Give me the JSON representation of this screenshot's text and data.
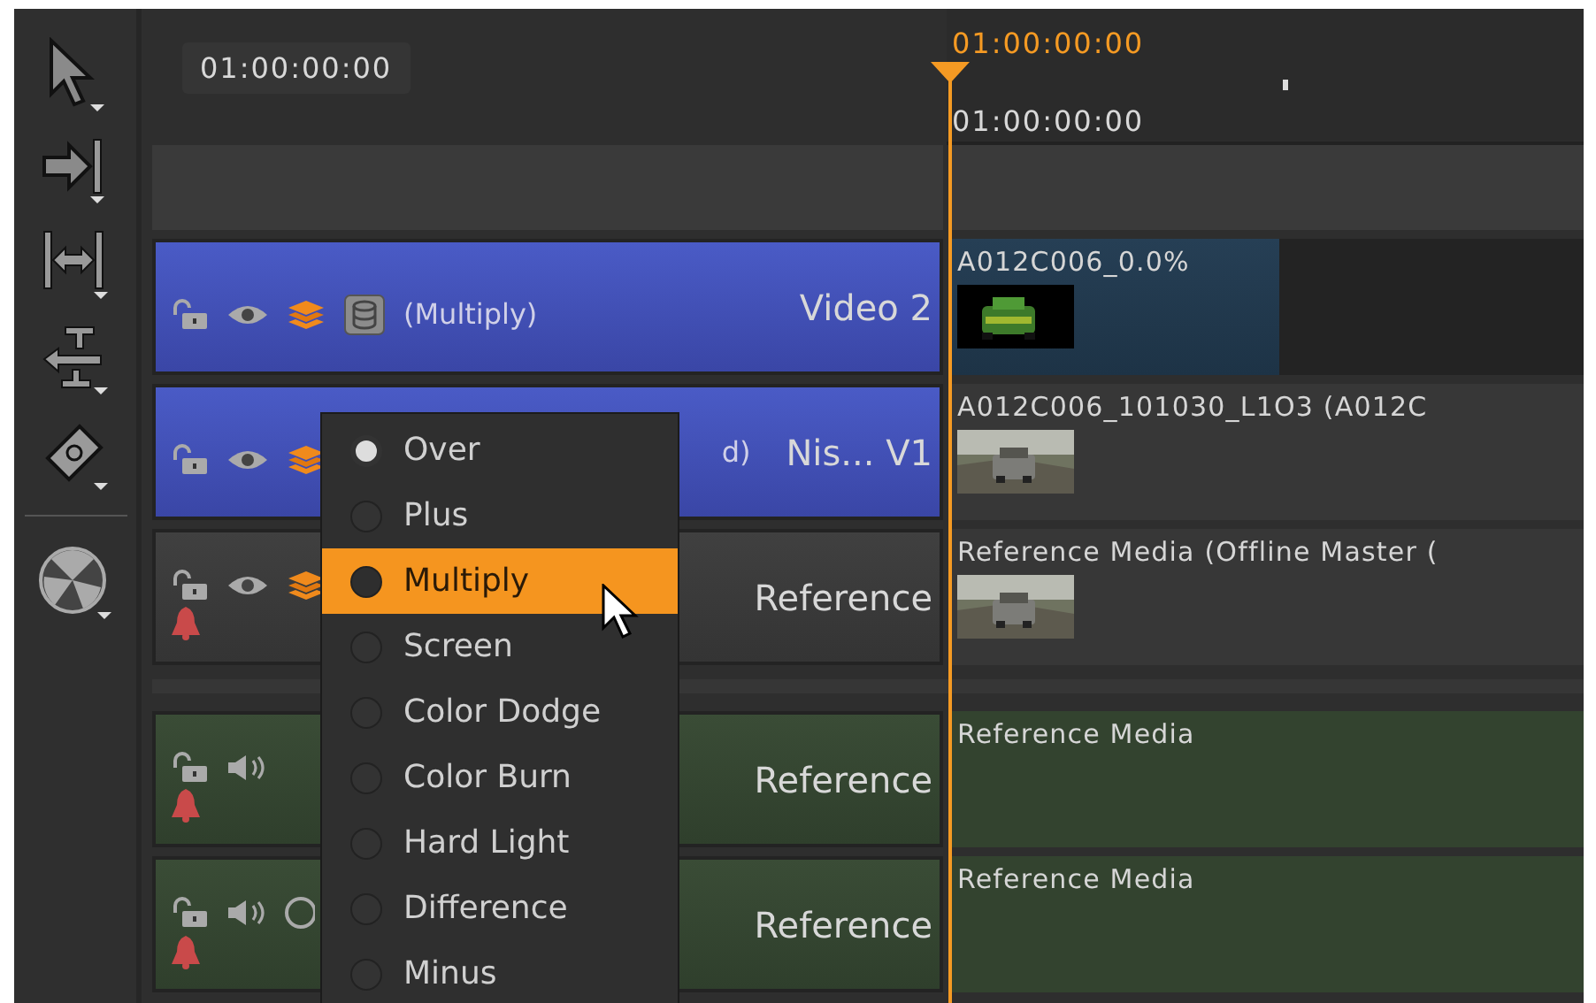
{
  "toolbar": {
    "tools": [
      {
        "kind": "pointer"
      },
      {
        "kind": "arrow-bar"
      },
      {
        "kind": "slip"
      },
      {
        "kind": "slide"
      },
      {
        "kind": "razor"
      },
      {
        "kind": "ball"
      }
    ]
  },
  "header": {
    "timecode": "01:00:00:00"
  },
  "ruler": {
    "playhead_timecode": "01:00:00:00",
    "start_timecode": "01:00:00:00"
  },
  "tracks": [
    {
      "kind": "video",
      "selected": true,
      "icons": [
        {
          "kind": "lock"
        },
        {
          "kind": "eye"
        },
        {
          "kind": "layers"
        },
        {
          "kind": "blend"
        }
      ],
      "bell": false,
      "blend_text": "(Multiply)",
      "name": "Video 2",
      "clip": {
        "kind": "effect",
        "name": "A012C006_0.0%"
      }
    },
    {
      "kind": "video",
      "selected": true,
      "icons": [
        {
          "kind": "lock"
        },
        {
          "kind": "eye"
        },
        {
          "kind": "layers"
        }
      ],
      "bell": false,
      "blend_text": "d)",
      "name": "Nis... V1",
      "clip": {
        "kind": "media",
        "name": "A012C006_101030_L1O3 (A012C"
      },
      "blend_menu": {
        "items": [
          {
            "label": "Over",
            "checked": true,
            "highlighted": false
          },
          {
            "label": "Plus",
            "checked": false,
            "highlighted": false
          },
          {
            "label": "Multiply",
            "checked": false,
            "highlighted": true
          },
          {
            "label": "Screen",
            "checked": false,
            "highlighted": false
          },
          {
            "label": "Color Dodge",
            "checked": false,
            "highlighted": false
          },
          {
            "label": "Color Burn",
            "checked": false,
            "highlighted": false
          },
          {
            "label": "Hard Light",
            "checked": false,
            "highlighted": false
          },
          {
            "label": "Difference",
            "checked": false,
            "highlighted": false
          },
          {
            "label": "Minus",
            "checked": false,
            "highlighted": false
          }
        ]
      }
    },
    {
      "kind": "video",
      "selected": false,
      "icons": [
        {
          "kind": "lock"
        },
        {
          "kind": "eye"
        },
        {
          "kind": "layers"
        }
      ],
      "bell": true,
      "name": "Reference",
      "clip": {
        "kind": "media",
        "name": "Reference Media (Offline Master ("
      }
    },
    {
      "kind": "audio",
      "selected": false,
      "icons": [
        {
          "kind": "lock"
        },
        {
          "kind": "speaker"
        }
      ],
      "bell": true,
      "name": "Reference",
      "clip": {
        "kind": "audio",
        "name": "Reference Media"
      }
    },
    {
      "kind": "audio",
      "selected": false,
      "icons": [
        {
          "kind": "lock"
        },
        {
          "kind": "speaker"
        },
        {
          "kind": "sync"
        }
      ],
      "bell": true,
      "name": "Reference",
      "clip": {
        "kind": "audio",
        "name": "Reference Media"
      }
    }
  ]
}
